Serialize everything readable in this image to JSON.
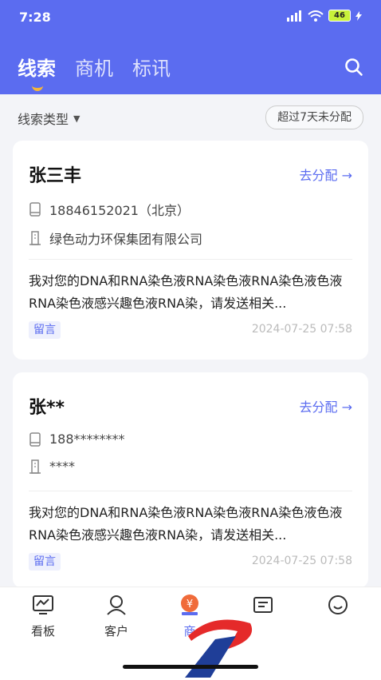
{
  "status": {
    "time": "7:28",
    "battery": "46"
  },
  "tabs": [
    "线索",
    "商机",
    "标讯"
  ],
  "filter": {
    "type_label": "线索类型",
    "chip_label": "超过7天未分配"
  },
  "cards": [
    {
      "name": "张三丰",
      "assign_label": "去分配 →",
      "phone": "18846152021（北京）",
      "company": "绿色动力环保集团有限公司",
      "message": "我对您的DNA和RNA染色液RNA染色液RNA染色液色液RNA染色液感兴趣色液RNA染，请发送相关...",
      "tag": "留言",
      "time": "2024-07-25 07:58"
    },
    {
      "name": "张**",
      "assign_label": "去分配 →",
      "phone": "188********",
      "company": "****",
      "message": "我对您的DNA和RNA染色液RNA染色液RNA染色液色液RNA染色液感兴趣色液RNA染，请发送相关...",
      "tag": "留言",
      "time": "2024-07-25 07:58"
    }
  ],
  "nav": [
    {
      "label": "看板",
      "icon": "chart-monitor-icon"
    },
    {
      "label": "客户",
      "icon": "user-icon"
    },
    {
      "label": "商",
      "icon": "yen-coin-icon"
    },
    {
      "label": "",
      "icon": "id-card-icon"
    },
    {
      "label": "",
      "icon": "smile-icon"
    }
  ],
  "colors": {
    "primary": "#5b6cf0",
    "accent": "#f5b63a",
    "coin": "#f06b3a"
  }
}
